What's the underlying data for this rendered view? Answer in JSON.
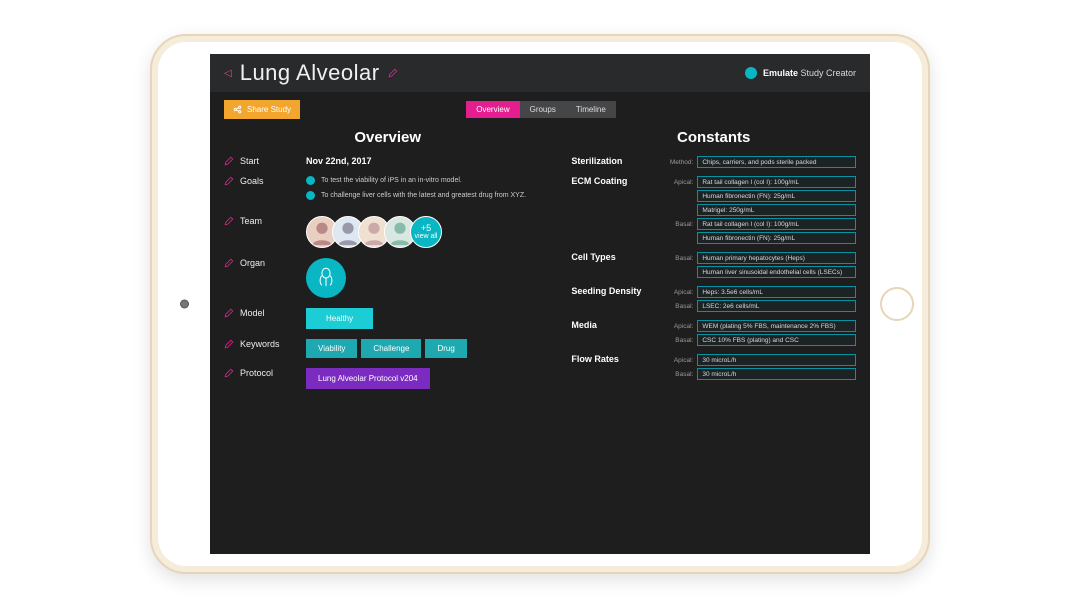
{
  "header": {
    "title": "Lung Alveolar",
    "brand_name": "Emulate",
    "brand_suffix": "Study Creator"
  },
  "toolbar": {
    "share_label": "Share Study",
    "tabs": [
      "Overview",
      "Groups",
      "Timeline"
    ],
    "active_tab": 0
  },
  "overview": {
    "section_title": "Overview",
    "labels": {
      "start": "Start",
      "goals": "Goals",
      "team": "Team",
      "organ": "Organ",
      "model": "Model",
      "keywords": "Keywords",
      "protocol": "Protocol"
    },
    "start_date": "Nov 22nd, 2017",
    "goals": [
      "To test the viability of iPS in an in-vitro model.",
      "To challenge liver cells with the latest and greatest drug from XYZ."
    ],
    "team_more_count": "+5",
    "team_more_label": "view all",
    "model": "Healthy",
    "keywords": [
      "Viability",
      "Challenge",
      "Drug"
    ],
    "protocol": "Lung Alveolar Protocol v204"
  },
  "constants": {
    "section_title": "Constants",
    "groups": [
      {
        "label": "Sterilization",
        "rows": [
          {
            "sub": "Method:",
            "val": "Chips, carriers, and pods sterile packed"
          }
        ]
      },
      {
        "label": "ECM Coating",
        "rows": [
          {
            "sub": "Apical:",
            "val": "Rat tail collagen I (col I): 100g/mL"
          },
          {
            "sub": "",
            "val": "Human fibronectin (FN): 25g/mL"
          },
          {
            "sub": "",
            "val": "Matrigel: 250g/mL"
          },
          {
            "sub": "Basal:",
            "val": "Rat tail collagen I (col I): 100g/mL"
          },
          {
            "sub": "",
            "val": "Human fibronectin (FN): 25g/mL"
          }
        ]
      },
      {
        "label": "Cell Types",
        "rows": [
          {
            "sub": "Basal:",
            "val": "Human primary hepatocytes (Heps)"
          },
          {
            "sub": "",
            "val": "Human liver sinusoidal endothelial cells (LSECs)"
          }
        ]
      },
      {
        "label": "Seeding Density",
        "rows": [
          {
            "sub": "Apical:",
            "val": "Heps: 3.5e6 cells/mL"
          },
          {
            "sub": "Basal:",
            "val": "LSEC: 2e6 cells/mL"
          }
        ]
      },
      {
        "label": "Media",
        "rows": [
          {
            "sub": "Apical:",
            "val": "WEM (plating 5% FBS, maintenance 2% FBS)"
          },
          {
            "sub": "Basal:",
            "val": "CSC 10% FBS (plating) and CSC"
          }
        ]
      },
      {
        "label": "Flow Rates",
        "rows": [
          {
            "sub": "Apical:",
            "val": "30 microL/h"
          },
          {
            "sub": "Basal:",
            "val": "30 microL/h"
          }
        ]
      }
    ]
  }
}
